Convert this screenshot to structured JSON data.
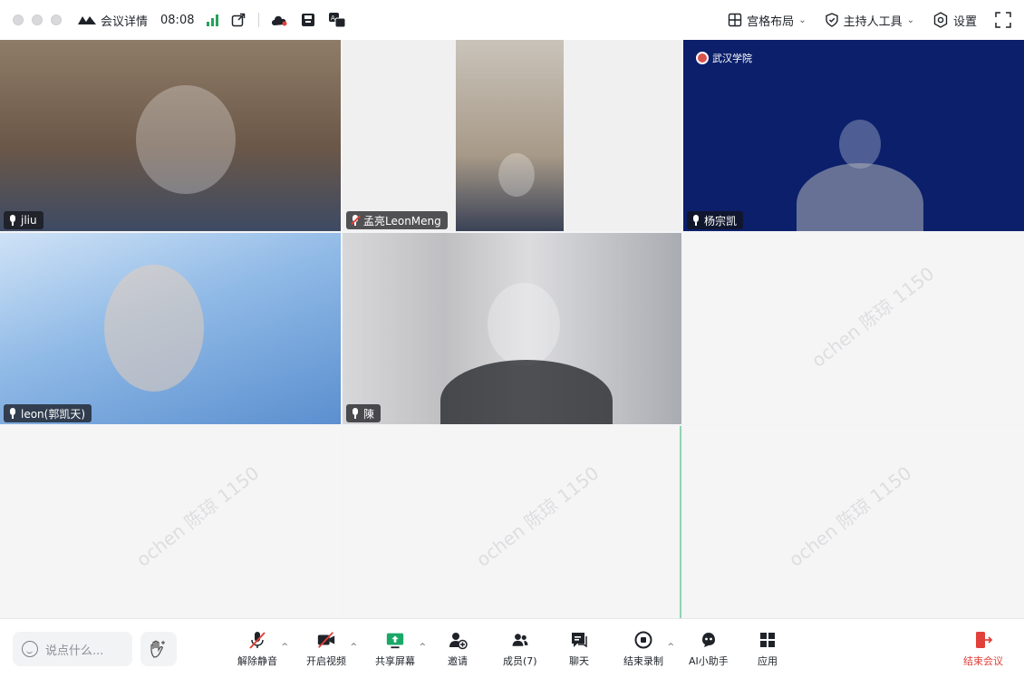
{
  "topbar": {
    "meeting_info": "会议详情",
    "timer": "08:08",
    "layout_label": "宫格布局",
    "host_tools_label": "主持人工具",
    "settings_label": "设置",
    "icons": [
      "meeting-logo-icon",
      "signal-icon",
      "popout-icon",
      "cloud-icon",
      "save-icon",
      "translate-icon",
      "grid-layout-icon",
      "shield-icon",
      "gear-icon",
      "fullscreen-icon"
    ]
  },
  "participants": [
    {
      "name": "jliu",
      "muted": false,
      "video": true
    },
    {
      "name": "孟亮LeonMeng",
      "muted": true,
      "video": true
    },
    {
      "name": "杨宗凯",
      "muted": false,
      "video": true,
      "badge": "武汉学院"
    },
    {
      "name": "leon(郭凯天)",
      "muted": false,
      "video": true
    },
    {
      "name": "陳",
      "muted": false,
      "video": true
    }
  ],
  "watermark": "ochen 陈琼 1150",
  "toolbar": {
    "chat_placeholder": "说点什么...",
    "mute_label": "解除静音",
    "video_label": "开启视频",
    "share_label": "共享屏幕",
    "invite_label": "邀请",
    "members_label": "成员(7)",
    "chat_label": "聊天",
    "record_label": "结束录制",
    "ai_label": "AI小助手",
    "apps_label": "应用",
    "end_label": "结束会议"
  },
  "colors": {
    "accent_green": "#22a35a",
    "end_red": "#e2403a",
    "share_green": "#1aa867",
    "navy_bg": "#0b1f6b"
  }
}
